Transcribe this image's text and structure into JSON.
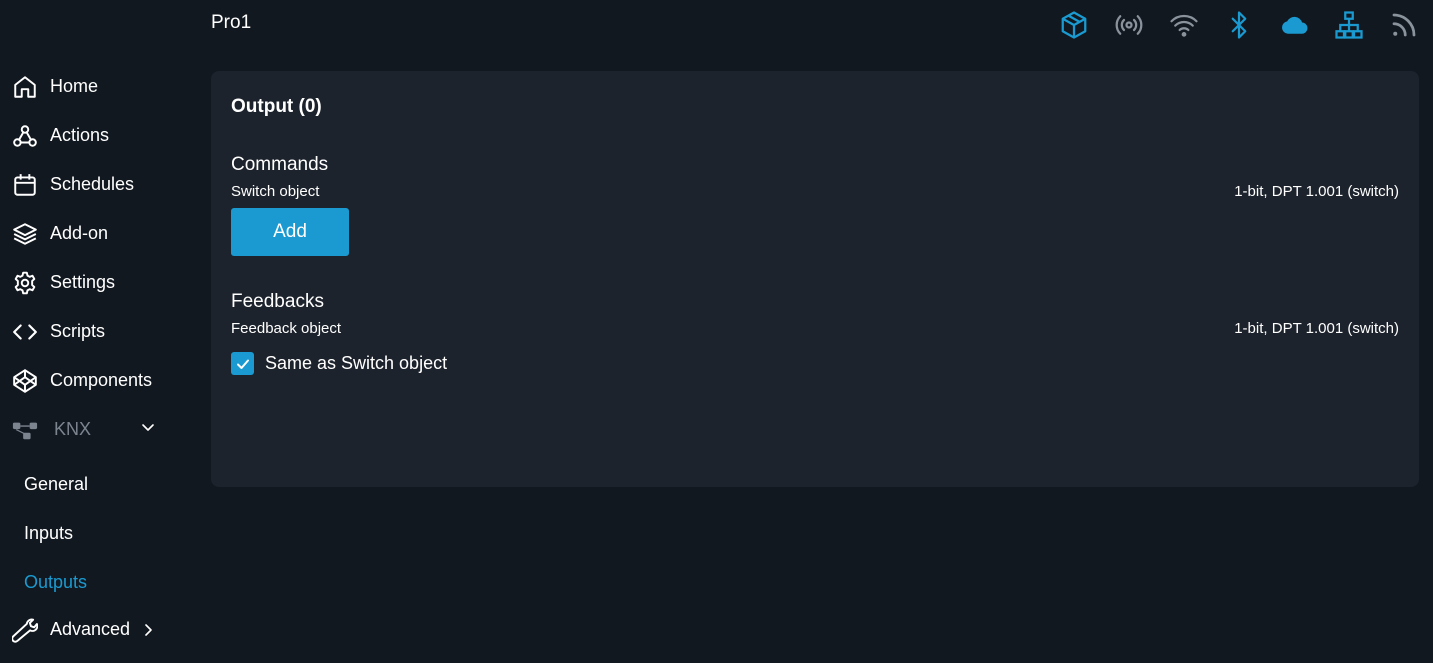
{
  "header": {
    "title": "Pro1",
    "status_icons": [
      "cube-icon",
      "broadcast-icon",
      "wifi-icon",
      "bluetooth-icon",
      "cloud-icon",
      "network-icon",
      "rss-icon"
    ]
  },
  "colors": {
    "accent": "#1a9ad0",
    "muted": "#7c8490",
    "background": "#121820",
    "card": "#1d232c"
  },
  "sidebar": {
    "items": [
      {
        "label": "Home",
        "icon": "home-icon"
      },
      {
        "label": "Actions",
        "icon": "webhook-icon"
      },
      {
        "label": "Schedules",
        "icon": "calendar-icon"
      },
      {
        "label": "Add-on",
        "icon": "layers-icon"
      },
      {
        "label": "Settings",
        "icon": "gear-icon"
      },
      {
        "label": "Scripts",
        "icon": "code-icon"
      },
      {
        "label": "Components",
        "icon": "codepen-icon"
      },
      {
        "label": "KNX",
        "icon": "knx-icon",
        "expanded": true,
        "disabled": true
      }
    ],
    "knx_sub_items": [
      {
        "label": "General",
        "active": false
      },
      {
        "label": "Inputs",
        "active": false
      },
      {
        "label": "Outputs",
        "active": true
      }
    ],
    "advanced": {
      "label": "Advanced",
      "icon": "wrench-icon"
    }
  },
  "main": {
    "card_title": "Output (0)",
    "commands": {
      "title": "Commands",
      "object_label": "Switch object",
      "object_type": "1-bit, DPT 1.001 (switch)",
      "add_label": "Add"
    },
    "feedbacks": {
      "title": "Feedbacks",
      "object_label": "Feedback object",
      "object_type": "1-bit, DPT 1.001 (switch)",
      "same_as_label": "Same as Switch object",
      "same_as_checked": true
    }
  }
}
